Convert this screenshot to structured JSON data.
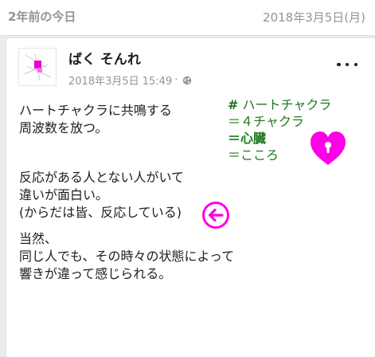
{
  "memory": {
    "title": "2年前の今日",
    "date": "2018年3月5日(月)"
  },
  "post": {
    "author": "ばく そんれ",
    "timestamp": "2018年3月5日 15:49",
    "separator": "·",
    "audience_icon": "globe-icon",
    "more_icon": "more-options-icon",
    "paragraphs": [
      [
        "ハートチャクラに共鳴する",
        "周波数を放つ。"
      ],
      [
        "反応がある人とない人がいて",
        "違いが面白い。",
        "(からだは皆、反応している)"
      ],
      [
        "当然、",
        "同じ人でも、その時々の状態によって",
        "響きが違って感じられる。"
      ]
    ],
    "hashtag_block": {
      "hash": "#",
      "line1": "ハートチャクラ",
      "line2": "＝４チャクラ",
      "line3": "＝心臓",
      "line4": "＝こころ"
    },
    "stickers": {
      "heart": "heart-keyhole-icon",
      "arrow": "arrow-left-circle-icon"
    }
  },
  "colors": {
    "background": "#e9ebee",
    "meta_gray": "#90949c",
    "text": "#1c1e21",
    "hashtag_green": "#1e7a1e",
    "sticker_magenta": "#ff00e6"
  }
}
